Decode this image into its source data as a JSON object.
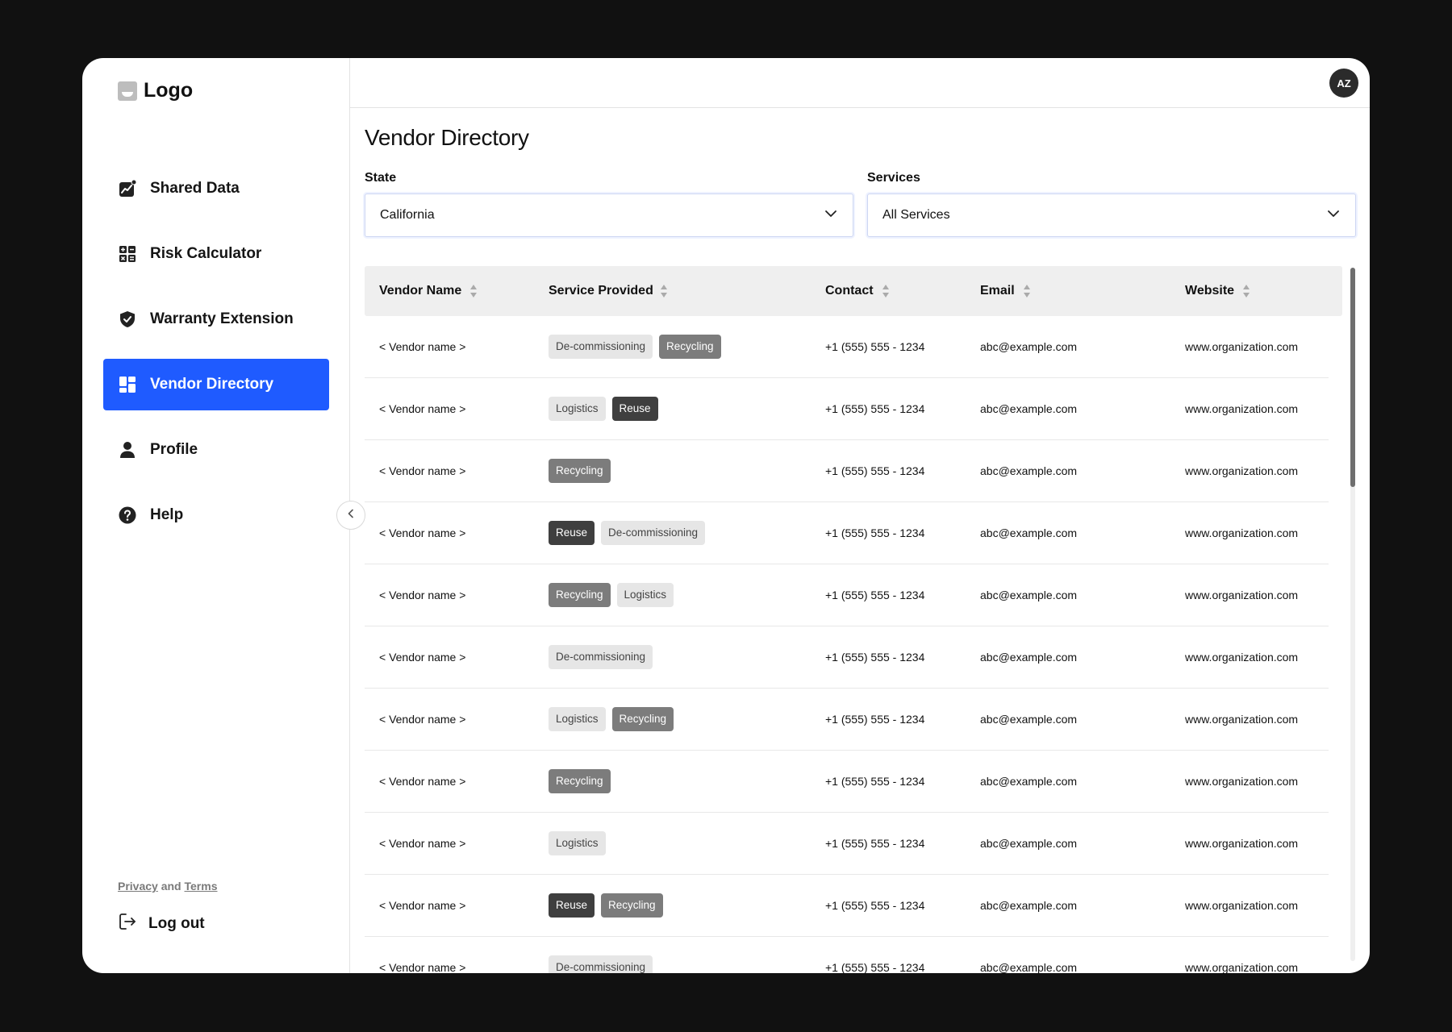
{
  "logo": {
    "text": "Logo"
  },
  "sidebar": {
    "items": [
      {
        "label": "Shared Data",
        "icon": "chart-icon"
      },
      {
        "label": "Risk Calculator",
        "icon": "calculator-icon"
      },
      {
        "label": "Warranty Extension",
        "icon": "shield-check-icon"
      },
      {
        "label": "Vendor Directory",
        "icon": "grid-icon",
        "active": true
      },
      {
        "label": "Profile",
        "icon": "user-icon"
      },
      {
        "label": "Help",
        "icon": "help-icon"
      }
    ],
    "legal": {
      "privacy": "Privacy",
      "and": "and",
      "terms": "Terms"
    },
    "logout": "Log out"
  },
  "header": {
    "avatar_initials": "AZ"
  },
  "page": {
    "title": "Vendor Directory"
  },
  "filters": {
    "state": {
      "label": "State",
      "value": "California"
    },
    "services": {
      "label": "Services",
      "value": "All Services"
    }
  },
  "colors": {
    "accent": "#1f5bff",
    "tag_light": "#e6e6e6",
    "tag_mid": "#7c7c7c",
    "tag_dark": "#3f3f3f"
  },
  "table": {
    "columns": [
      "Vendor Name",
      "Service Provided",
      "Contact",
      "Email",
      "Website"
    ],
    "rows": [
      {
        "vendor": "< Vendor name >",
        "services": [
          {
            "label": "De-commissioning",
            "style": "light"
          },
          {
            "label": "Recycling",
            "style": "mid"
          }
        ],
        "contact": "+1 (555) 555 - 1234",
        "email": "abc@example.com",
        "website": "www.organization.com"
      },
      {
        "vendor": "< Vendor name >",
        "services": [
          {
            "label": "Logistics",
            "style": "light"
          },
          {
            "label": "Reuse",
            "style": "dark"
          }
        ],
        "contact": "+1 (555) 555 - 1234",
        "email": "abc@example.com",
        "website": "www.organization.com"
      },
      {
        "vendor": "< Vendor name >",
        "services": [
          {
            "label": "Recycling",
            "style": "mid"
          }
        ],
        "contact": "+1 (555) 555 - 1234",
        "email": "abc@example.com",
        "website": "www.organization.com"
      },
      {
        "vendor": "< Vendor name >",
        "services": [
          {
            "label": "Reuse",
            "style": "dark"
          },
          {
            "label": "De-commissioning",
            "style": "light"
          }
        ],
        "contact": "+1 (555) 555 - 1234",
        "email": "abc@example.com",
        "website": "www.organization.com"
      },
      {
        "vendor": "< Vendor name >",
        "services": [
          {
            "label": "Recycling",
            "style": "mid"
          },
          {
            "label": "Logistics",
            "style": "light"
          }
        ],
        "contact": "+1 (555) 555 - 1234",
        "email": "abc@example.com",
        "website": "www.organization.com"
      },
      {
        "vendor": "< Vendor name >",
        "services": [
          {
            "label": "De-commissioning",
            "style": "light"
          }
        ],
        "contact": "+1 (555) 555 - 1234",
        "email": "abc@example.com",
        "website": "www.organization.com"
      },
      {
        "vendor": "< Vendor name >",
        "services": [
          {
            "label": "Logistics",
            "style": "light"
          },
          {
            "label": "Recycling",
            "style": "mid"
          }
        ],
        "contact": "+1 (555) 555 - 1234",
        "email": "abc@example.com",
        "website": "www.organization.com"
      },
      {
        "vendor": "< Vendor name >",
        "services": [
          {
            "label": "Recycling",
            "style": "mid"
          }
        ],
        "contact": "+1 (555) 555 - 1234",
        "email": "abc@example.com",
        "website": "www.organization.com"
      },
      {
        "vendor": "< Vendor name >",
        "services": [
          {
            "label": "Logistics",
            "style": "light"
          }
        ],
        "contact": "+1 (555) 555 - 1234",
        "email": "abc@example.com",
        "website": "www.organization.com"
      },
      {
        "vendor": "< Vendor name >",
        "services": [
          {
            "label": "Reuse",
            "style": "dark"
          },
          {
            "label": "Recycling",
            "style": "mid"
          }
        ],
        "contact": "+1 (555) 555 - 1234",
        "email": "abc@example.com",
        "website": "www.organization.com"
      },
      {
        "vendor": "< Vendor name >",
        "services": [
          {
            "label": "De-commissioning",
            "style": "light"
          }
        ],
        "contact": "+1 (555) 555 - 1234",
        "email": "abc@example.com",
        "website": "www.organization.com"
      }
    ]
  }
}
